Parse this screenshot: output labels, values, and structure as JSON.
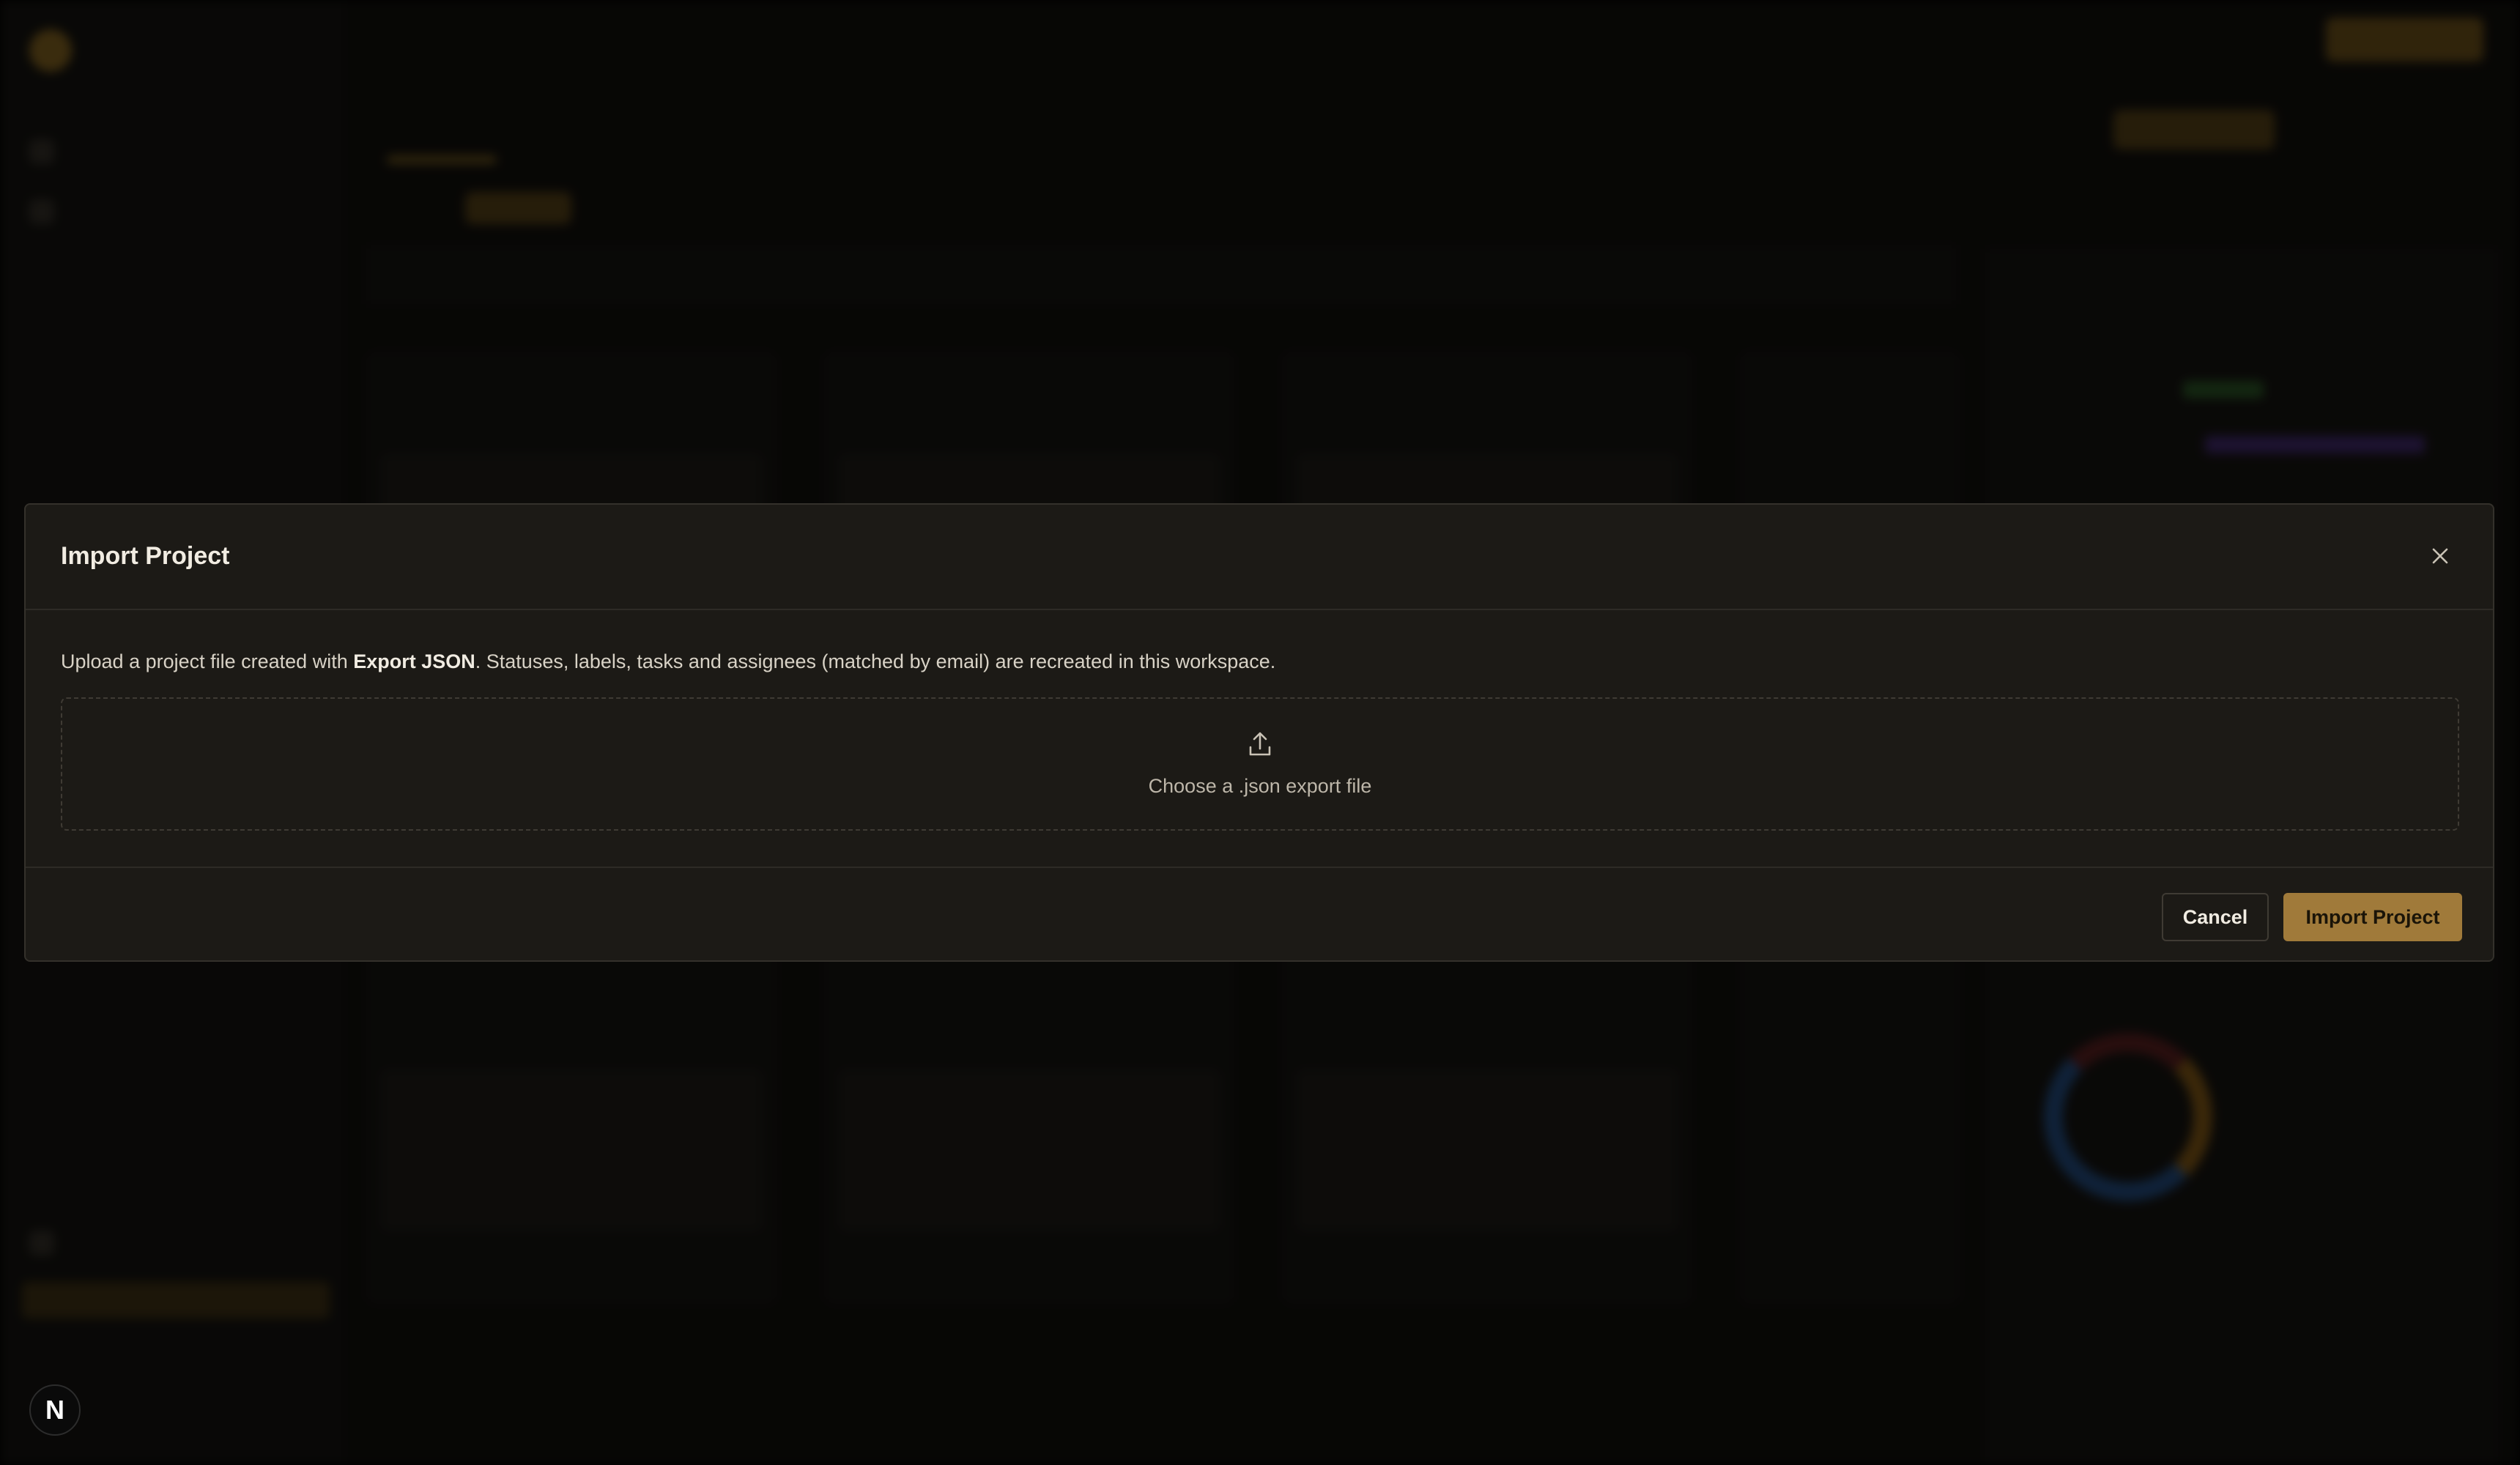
{
  "modal": {
    "title": "Import Project",
    "description_prefix": "Upload a project file created with ",
    "description_bold": "Export JSON",
    "description_suffix": ". Statuses, labels, tasks and assignees (matched by email) are recreated in this workspace.",
    "dropzone_label": "Choose a .json export file",
    "cancel_label": "Cancel",
    "import_label": "Import Project"
  },
  "badge": {
    "label": "N"
  },
  "icons": {
    "close": "close-icon",
    "upload": "upload-icon"
  },
  "colors": {
    "accent": "#a07a3a",
    "modal_bg": "#1c1a16",
    "overlay_bg": "#000000"
  }
}
